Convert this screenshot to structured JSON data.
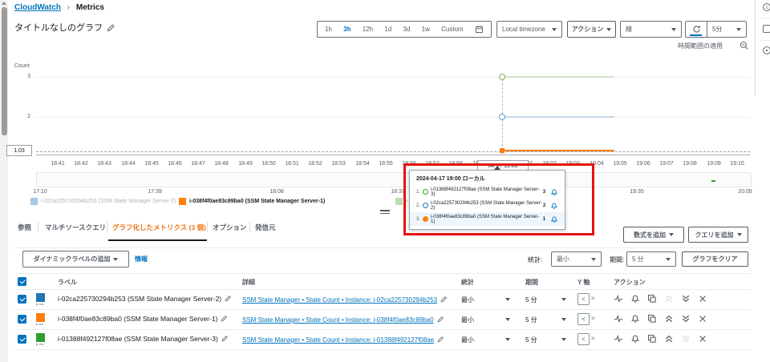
{
  "breadcrumb": {
    "home": "CloudWatch",
    "current": "Metrics"
  },
  "header": {
    "title": "タイトルなしのグラフ"
  },
  "toolbar": {
    "ranges": [
      "1h",
      "3h",
      "12h",
      "1d",
      "3d",
      "1w",
      "Custom"
    ],
    "selected_range": "3h",
    "timezone": "Local timezone",
    "actions_label": "アクション",
    "graph_type": "線",
    "refresh_interval": "5分",
    "apply_label": "時間範囲の適用"
  },
  "chart_data": {
    "type": "line",
    "ylabel": "Count",
    "yticks": [
      "3",
      "2"
    ],
    "ymin_badge": "1.03",
    "hover_x_label": "04-17 19:00",
    "x_labels": [
      "18:41",
      "18:42",
      "18:43",
      "18:44",
      "18:45",
      "18:46",
      "18:47",
      "18:48",
      "18:49",
      "18:50",
      "18:51",
      "18:52",
      "18:53",
      "18:54",
      "18:55",
      "18:56",
      "18:57",
      "18:58",
      "18:59",
      "19:00",
      "19:01",
      "19:02",
      "19:03",
      "19:04",
      "19:05",
      "19:06",
      "19:07",
      "19:08",
      "19:09",
      "19:10"
    ],
    "overview_labels": [
      "17:10",
      "17:39",
      "18:08",
      "18:37",
      "19:35",
      "20:05"
    ],
    "series": [
      {
        "name": "i-01388f492127f08ae (SSM State Manager Server-3)",
        "color": "#2ca02c",
        "x": [
          "19:00",
          "19:05"
        ],
        "value": 3,
        "dimmed": true
      },
      {
        "name": "i-02ca225730294b253 (SSM State Manager Server-2)",
        "color": "#1f77b4",
        "x": [
          "19:00",
          "19:05"
        ],
        "value": 2,
        "dimmed": true
      },
      {
        "name": "i-038f4f0ae83c89ba0 (SSM State Manager Server-1)",
        "color": "#ff7f0e",
        "x": [
          "19:00",
          "19:05"
        ],
        "value": 1,
        "dimmed": false
      }
    ]
  },
  "tooltip": {
    "title": "2024-04-17 19:00 ローカル",
    "rows": [
      {
        "num": "1.",
        "label": "i-01388f492127f08ae (SSM State Manager Server-3)",
        "value": "3"
      },
      {
        "num": "2.",
        "label": "i-02ca225730294b253 (SSM State Manager Server-2)",
        "value": "2"
      },
      {
        "num": "3.",
        "label": "i-038f4f0ae83c89ba0 (SSM State Manager Server-1)",
        "value": "1"
      }
    ]
  },
  "legend": {
    "items": [
      {
        "label": "i-02ca225730294b253 (SSM State Manager Server-2)"
      },
      {
        "label": "i-038f4f0ae83c89ba0 (SSM State Manager Server-1)"
      },
      {
        "label": "i-01388f492127f08ae (SSM State Manager Server-3)"
      }
    ]
  },
  "tabs": {
    "items": [
      "参照",
      "マルチソースクエリ",
      "グラフ化したメトリクス (3 個)",
      "オプション",
      "発信元"
    ],
    "active": "グラフ化したメトリクス (3 個)"
  },
  "panel": {
    "add_math": "数式を追加",
    "add_query": "クエリを追加",
    "add_dynamic_label": "ダイナミックラベルの追加",
    "info": "情報",
    "stat_label": "統計:",
    "stat_value": "最小",
    "period_label": "期間:",
    "period_value": "5 分",
    "clear_graph": "グラフをクリア"
  },
  "table": {
    "headers": [
      "ラベル",
      "詳細",
      "統計",
      "期間",
      "Y 軸",
      "アクション"
    ],
    "rows": [
      {
        "label": "i-02ca225730294b253 (SSM State Manager Server-2)",
        "detail": "SSM State Manager • State Count • Instance: i-02ca225730294b253",
        "stat": "最小",
        "period": "5 分"
      },
      {
        "label": "i-038f4f0ae83c89ba0 (SSM State Manager Server-1)",
        "detail": "SSM State Manager • State Count • Instance: i-038f4f0ae83c89ba0",
        "stat": "最小",
        "period": "5 分"
      },
      {
        "label": "i-01388f492127f08ae (SSM State Manager Server-3)",
        "detail": "SSM State Manager • State Count • Instance: i-01388f492127f08ae",
        "stat": "最小",
        "period": "5 分"
      }
    ]
  },
  "colors": {
    "accent": "#0073bb",
    "active_tab": "#ec7211",
    "annotation": "#e8100c",
    "series_blue": "#1f77b4",
    "series_orange": "#ff7f0e",
    "series_green": "#2ca02c"
  }
}
